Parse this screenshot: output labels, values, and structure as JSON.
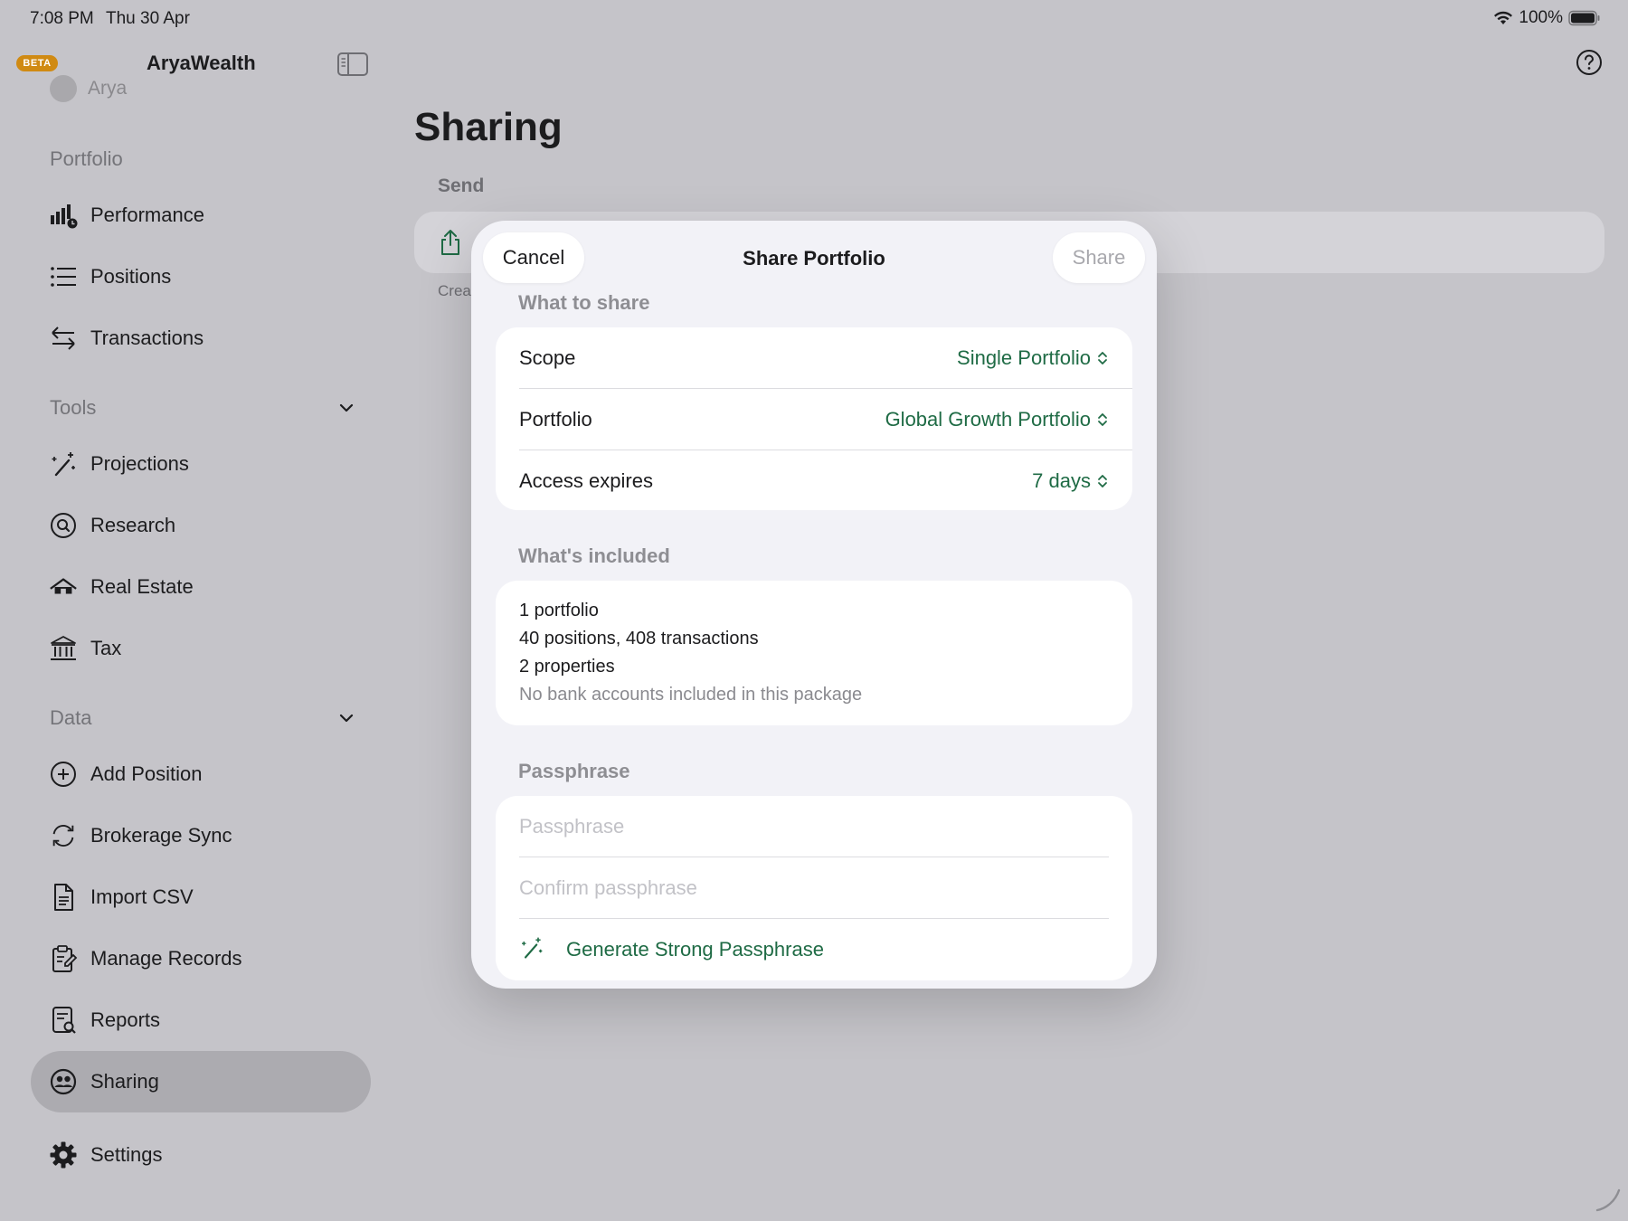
{
  "status_bar": {
    "time": "7:08 PM",
    "date": "Thu 30 Apr",
    "battery": "100%"
  },
  "sidebar": {
    "badge": "BETA",
    "app_name": "AryaWealth",
    "profile_name": "Arya",
    "sections": {
      "portfolio": "Portfolio",
      "tools": "Tools",
      "data": "Data"
    },
    "items": {
      "performance": "Performance",
      "positions": "Positions",
      "transactions": "Transactions",
      "projections": "Projections",
      "research": "Research",
      "real_estate": "Real Estate",
      "tax": "Tax",
      "add_position": "Add Position",
      "brokerage_sync": "Brokerage Sync",
      "import_csv": "Import CSV",
      "manage_records": "Manage Records",
      "reports": "Reports",
      "sharing": "Sharing",
      "settings": "Settings"
    },
    "active_item": "Sharing"
  },
  "main": {
    "title": "Sharing",
    "send_label": "Send",
    "send_caption": "Crea"
  },
  "modal": {
    "title": "Share Portfolio",
    "cancel_label": "Cancel",
    "share_label": "Share",
    "what_to_share": {
      "label": "What to share",
      "rows": [
        {
          "label": "Scope",
          "value": "Single Portfolio"
        },
        {
          "label": "Portfolio",
          "value": "Global Growth Portfolio"
        },
        {
          "label": "Access expires",
          "value": "7 days"
        }
      ]
    },
    "whats_included": {
      "label": "What's included",
      "lines": [
        "1 portfolio",
        "40 positions, 408 transactions",
        "2 properties",
        "No bank accounts included in this package"
      ]
    },
    "passphrase": {
      "label": "Passphrase",
      "passphrase_value": "",
      "passphrase_placeholder": "Passphrase",
      "confirm_value": "",
      "confirm_placeholder": "Confirm passphrase",
      "generate_label": "Generate Strong Passphrase"
    }
  },
  "colors": {
    "accent": "#1f6b45",
    "badge": "#d08a12",
    "dimmed_background": "#c5c4c9",
    "sidebar_active": "#acabb0"
  }
}
